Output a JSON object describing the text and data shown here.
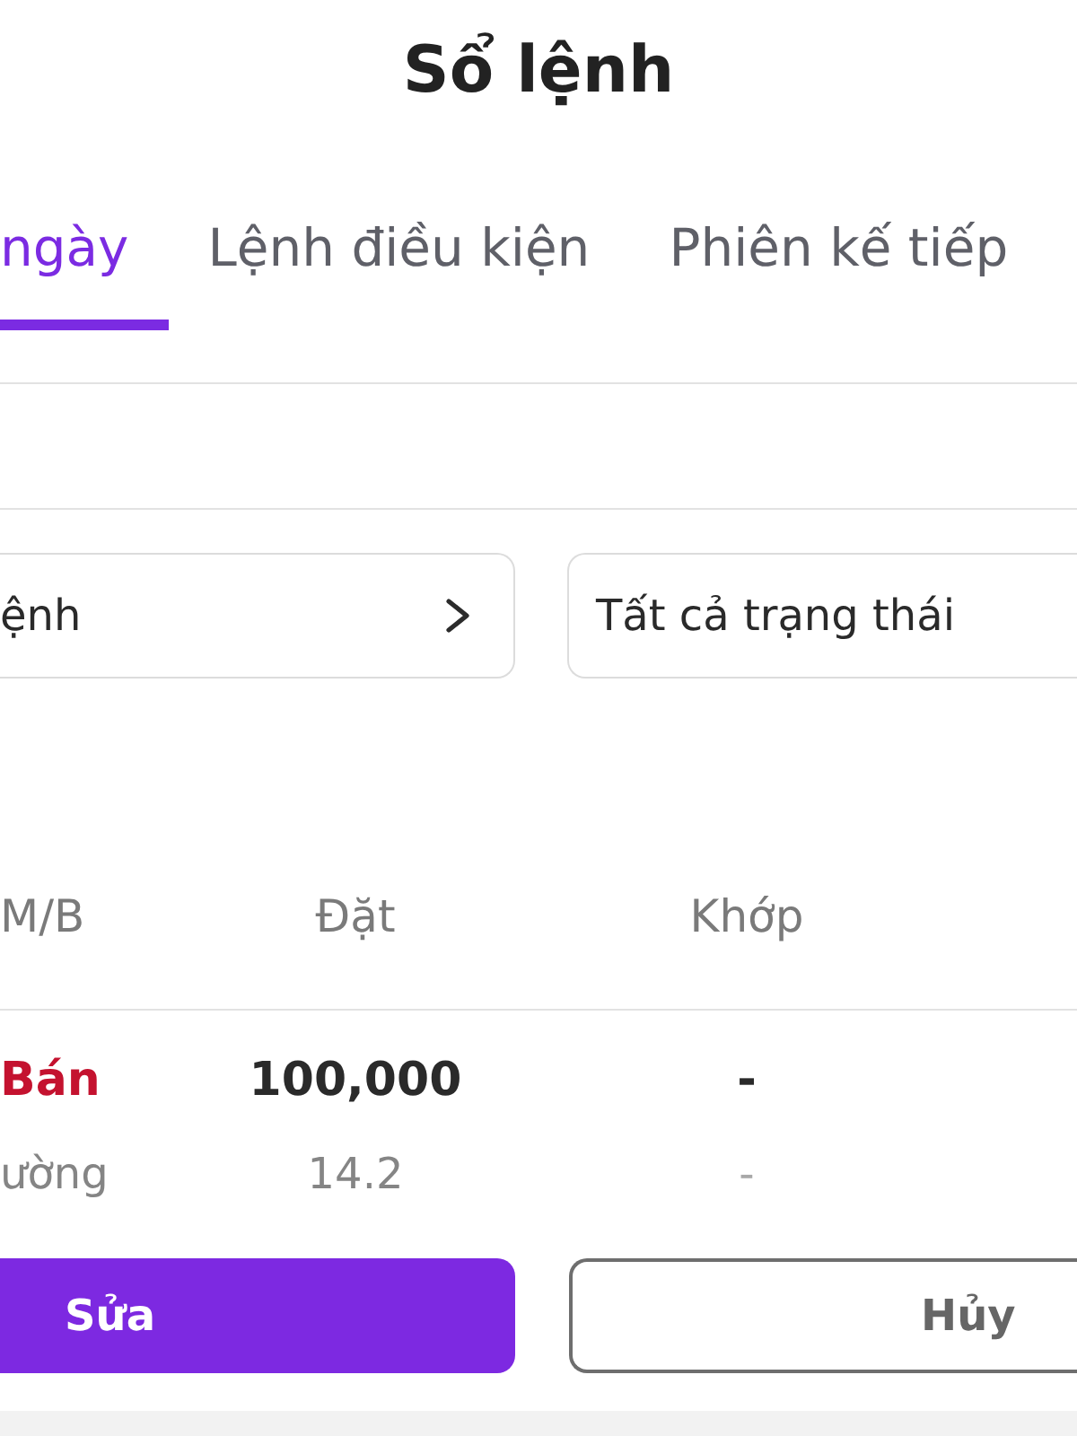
{
  "header": {
    "title": "Sổ lệnh"
  },
  "tabs": [
    {
      "label": "ngày",
      "selected": true
    },
    {
      "label": "Lệnh điều kiện",
      "selected": false
    },
    {
      "label": "Phiên kế tiếp",
      "selected": false
    }
  ],
  "filters": [
    {
      "value": "ệnh",
      "kind": "nav"
    },
    {
      "value": "Tất cả trạng thái",
      "kind": "select"
    }
  ],
  "table": {
    "columns": [
      "M/B",
      "Đặt",
      "Khớp"
    ],
    "rows": [
      {
        "kind": "sell",
        "cells": [
          "Bán",
          "100,000",
          "-"
        ],
        "subcells": [
          "ường",
          "14.2",
          "-"
        ]
      }
    ]
  },
  "buttons": [
    {
      "label": "Sửa",
      "kind": "primary"
    },
    {
      "label": "Hủy",
      "kind": "outline"
    }
  ]
}
